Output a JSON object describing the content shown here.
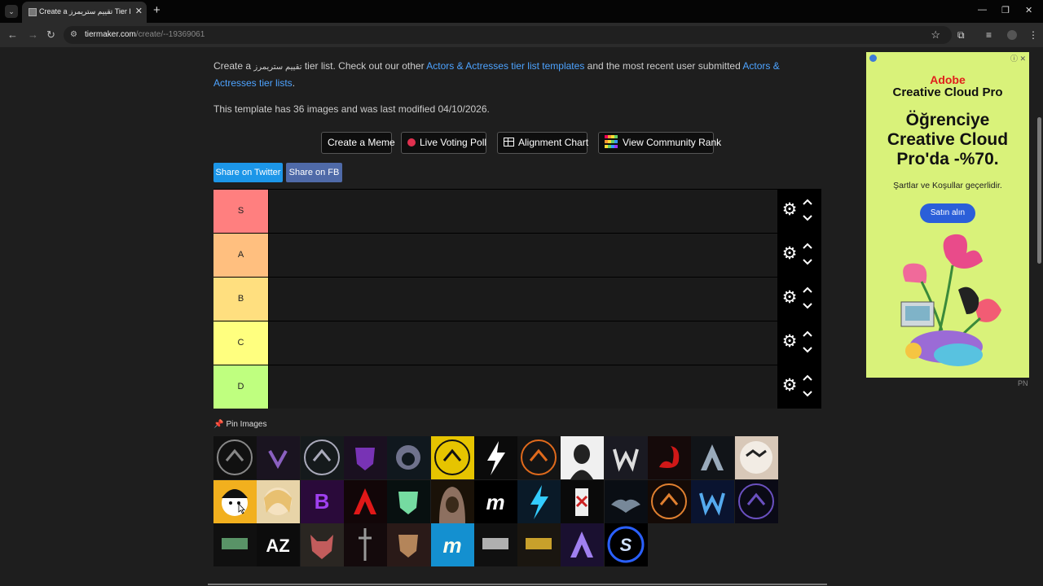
{
  "browser": {
    "tab_title": "Create a تقييم ستريمرز Tier List",
    "url_host": "tiermaker.com",
    "url_path": "/create/--19369061"
  },
  "intro": {
    "part1": "Create a ",
    "arabic": "تقييم ستريمرز",
    "part2": " tier list. Check out our other ",
    "link1": "Actors & Actresses tier list templates",
    "part3": " and the most recent user submitted ",
    "link2": "Actors & Actresses tier lists",
    "part4": "."
  },
  "meta": "This template has 36 images and was last modified 04/10/2026.",
  "actions": {
    "meme": "Create a Meme",
    "poll": "Live Voting Poll",
    "alignment": "Alignment Chart",
    "community": "View Community Rank"
  },
  "share": {
    "twitter": "Share on Twitter",
    "fb": "Share on FB"
  },
  "tiers": [
    {
      "label": "S",
      "color": "#ff7f7f"
    },
    {
      "label": "A",
      "color": "#ffbf7f"
    },
    {
      "label": "B",
      "color": "#ffdf7f"
    },
    {
      "label": "C",
      "color": "#ffff7f"
    },
    {
      "label": "D",
      "color": "#bfff7f"
    }
  ],
  "pin_label": "Pin Images",
  "image_count": 36,
  "ad": {
    "brand1": "Adobe",
    "brand2": "Creative Cloud Pro",
    "headline": "Öğrenciye Creative Cloud Pro'da -%70.",
    "terms": "Şartlar ve Koşullar geçerlidir.",
    "cta": "Satın alın",
    "tag": "PN"
  }
}
